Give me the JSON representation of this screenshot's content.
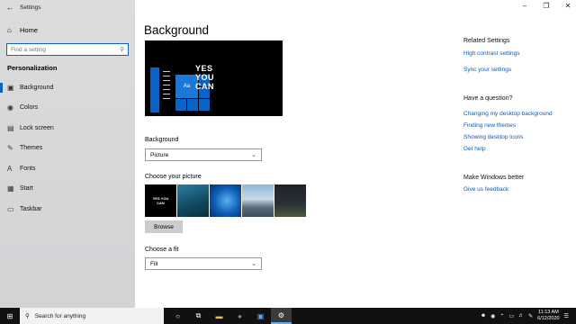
{
  "window": {
    "title": "Settings"
  },
  "sidebar": {
    "home_label": "Home",
    "search_placeholder": "Find a setting",
    "section_title": "Personalization",
    "items": [
      {
        "label": "Background",
        "icon": "picture-icon"
      },
      {
        "label": "Colors",
        "icon": "palette-icon"
      },
      {
        "label": "Lock screen",
        "icon": "lock-screen-icon"
      },
      {
        "label": "Themes",
        "icon": "brush-icon"
      },
      {
        "label": "Fonts",
        "icon": "fonts-icon"
      },
      {
        "label": "Start",
        "icon": "start-icon"
      },
      {
        "label": "Taskbar",
        "icon": "taskbar-icon"
      }
    ]
  },
  "main": {
    "title": "Background",
    "preview_text": "YES YOU CAN",
    "preview_tile_label": "Aa",
    "background_label": "Background",
    "background_value": "Picture",
    "choose_picture_label": "Choose your picture",
    "thumb1_text": "YES YOU CAN",
    "browse_label": "Browse",
    "fit_label": "Choose a fit",
    "fit_value": "Fill"
  },
  "related": {
    "heading": "Related Settings",
    "links": [
      "High contrast settings",
      "Sync your settings"
    ]
  },
  "question": {
    "heading": "Have a question?",
    "links": [
      "Changing my desktop background",
      "Finding new themes",
      "Showing desktop icons",
      "Get help"
    ]
  },
  "improve": {
    "heading": "Make Windows better",
    "link": "Give us feedback"
  },
  "taskbar": {
    "search_text": "Search for anything",
    "time": "11:13 AM",
    "date": "6/12/2020"
  },
  "colors": {
    "accent": "#0a64c8",
    "link": "#0a5cb8"
  }
}
